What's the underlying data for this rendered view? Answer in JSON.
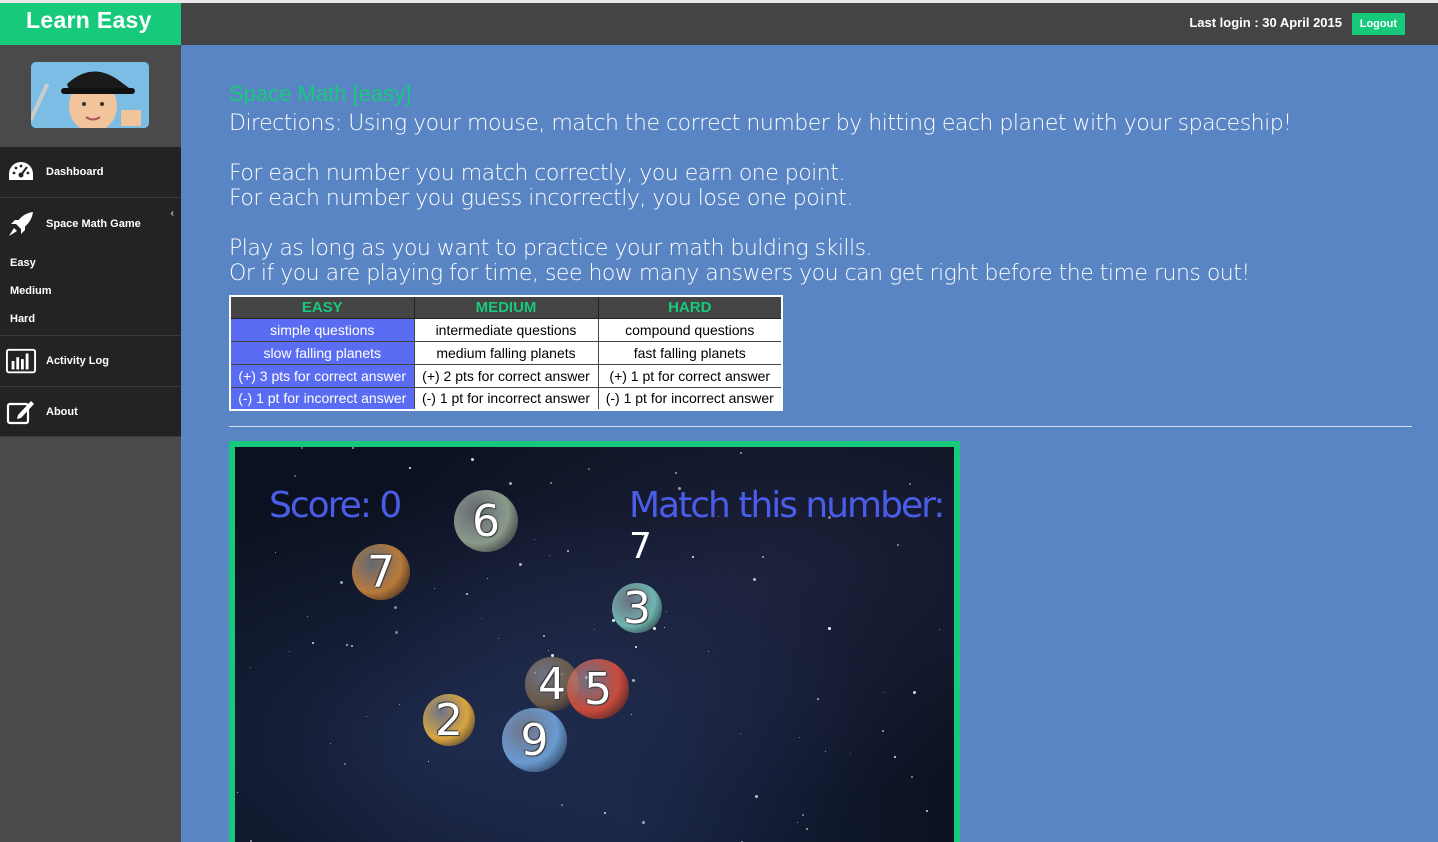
{
  "app": {
    "brand": "Learn Easy",
    "last_login": "Last login : 30 April 2015",
    "logout_label": "Logout"
  },
  "sidebar": {
    "items": [
      {
        "label": "Dashboard",
        "icon": "dashboard-icon"
      },
      {
        "label": "Space Math Game",
        "icon": "rocket-icon"
      },
      {
        "label": "Activity Log",
        "icon": "bar-chart-icon"
      },
      {
        "label": "About",
        "icon": "edit-icon"
      }
    ],
    "sub_items": [
      "Easy",
      "Medium",
      "Hard"
    ]
  },
  "main": {
    "title": "Space Math [easy]",
    "directions": [
      "Directions: Using your mouse, match the correct number by hitting each planet with your spaceship!",
      "For each number you match correctly, you earn one point.",
      "For each number you guess incorrectly, you lose one point.",
      "Play as long as you want to practice your math bulding skills.",
      "Or if you are playing for time, see how many answers you can get right before the time runs out!"
    ],
    "table": {
      "headers": [
        "EASY",
        "MEDIUM",
        "HARD"
      ],
      "rows": [
        [
          "simple questions",
          "intermediate questions",
          "compound questions"
        ],
        [
          "slow falling planets",
          "medium falling planets",
          "fast falling planets"
        ],
        [
          "(+) 3 pts for correct answer",
          "(+) 2 pts for correct answer",
          "(+) 1 pt for correct answer"
        ],
        [
          "(-) 1 pt for incorrect answer",
          "(-) 1 pt for incorrect answer",
          "(-) 1 pt for incorrect answer"
        ]
      ]
    }
  },
  "game": {
    "score_label": "Score:",
    "score_value": "0",
    "match_label": "Match this number:",
    "match_value": "7",
    "planets": [
      {
        "number": "6",
        "color": "#8a9a8a"
      },
      {
        "number": "7",
        "color": "#b87a3a"
      },
      {
        "number": "3",
        "color": "#6fb5b0"
      },
      {
        "number": "4",
        "color": "#6a5a4a"
      },
      {
        "number": "5",
        "color": "#c84a3a"
      },
      {
        "number": "2",
        "color": "#d9a540"
      },
      {
        "number": "9",
        "color": "#6a9ad0"
      }
    ]
  },
  "colors": {
    "accent": "#17c97a",
    "main_bg": "#5a85c4",
    "easy_cell": "#5a6df2",
    "score_text": "#4a5de8"
  }
}
